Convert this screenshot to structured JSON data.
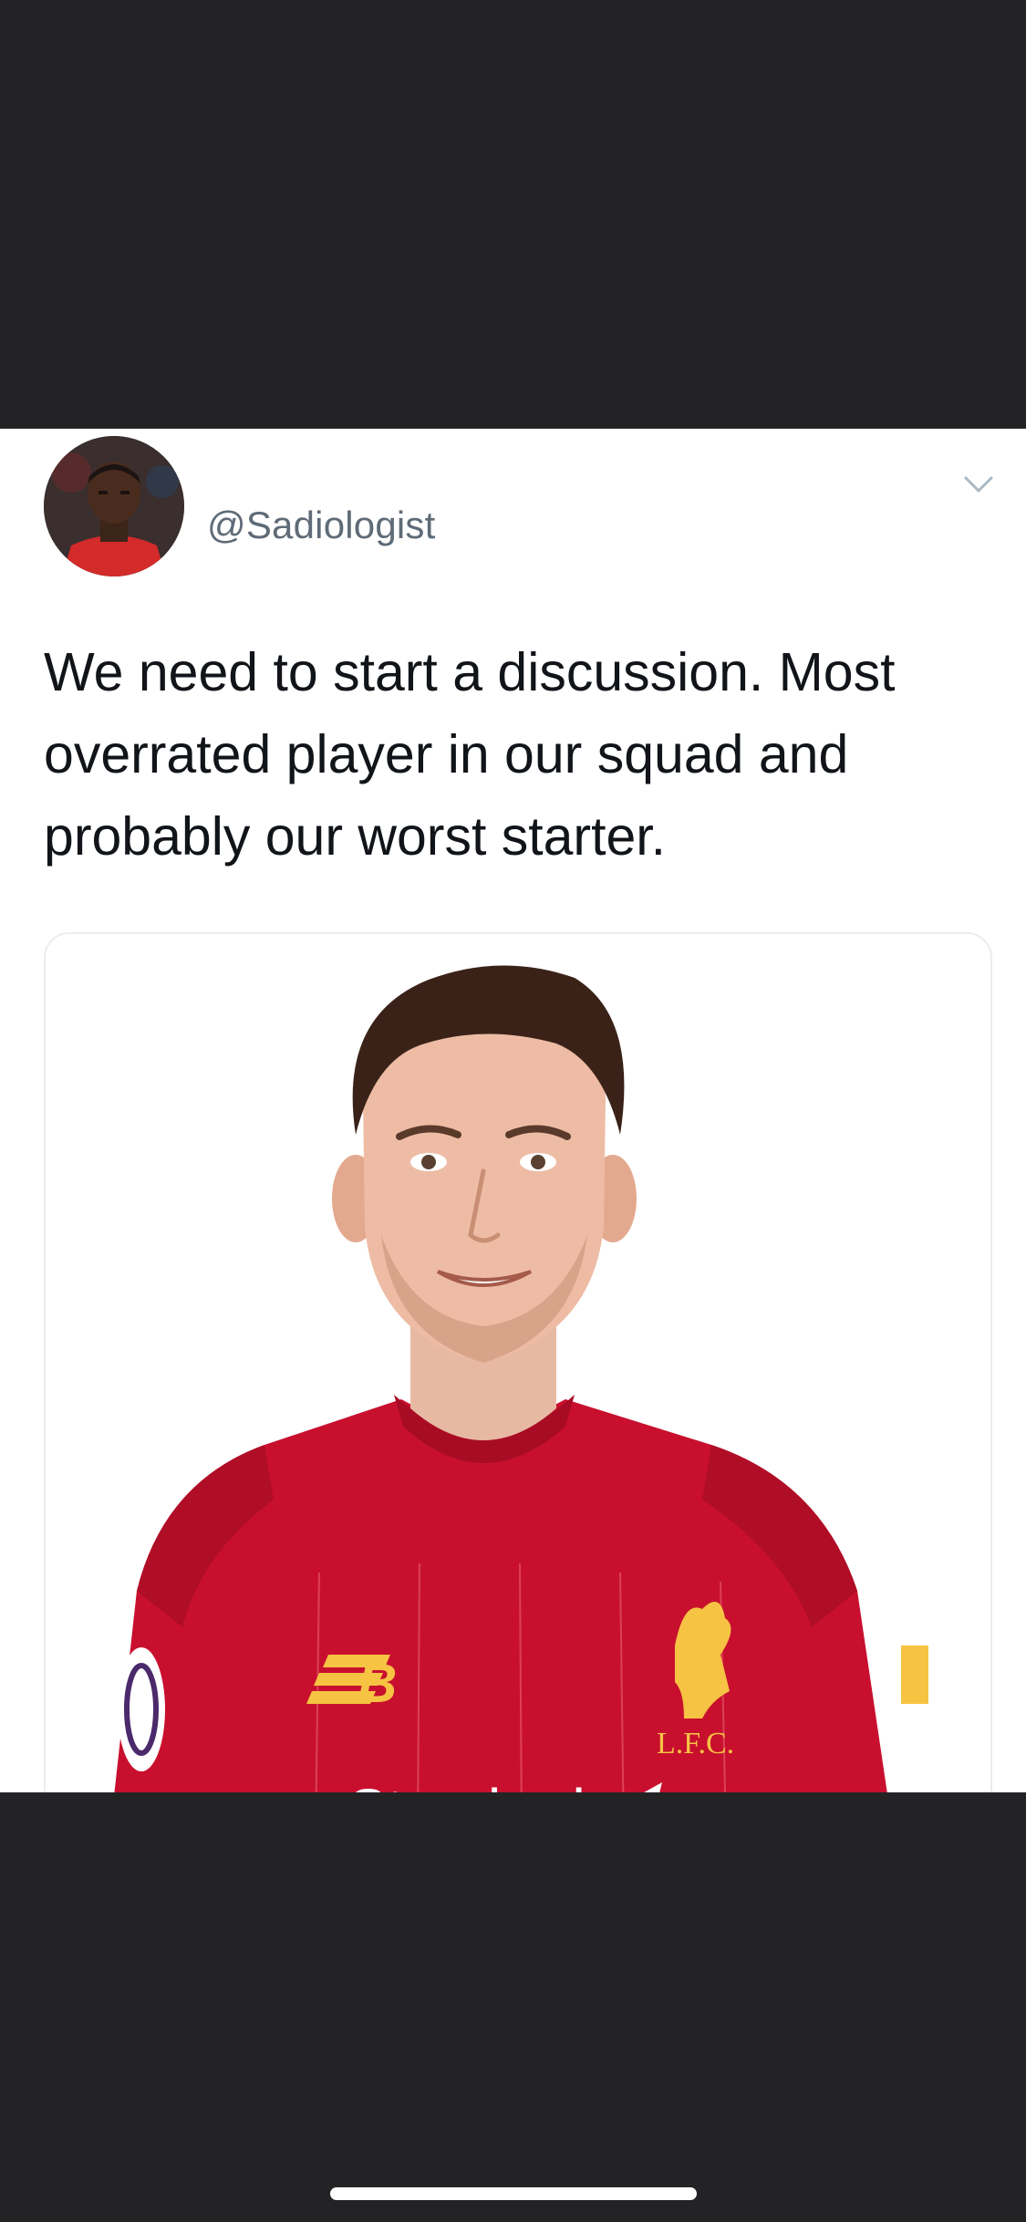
{
  "tweet": {
    "handle": "@Sadiologist",
    "text": "We need to start a discussion. Most overrated player in our squad and probably our worst starter.",
    "menu_icon": "chevron-down-icon",
    "avatar_icon": "profile-photo"
  },
  "media": {
    "crest_text": "L.F.C.",
    "sponsor_text": "Standard",
    "kit_brand_icon": "nb-logo-icon",
    "sleeve_badge_icon": "league-badge-icon"
  },
  "colors": {
    "background": "#232325",
    "card": "#ffffff",
    "text": "#111418",
    "handle": "#5f6b77",
    "kit_red": "#c8102e",
    "kit_gold": "#f6c343"
  }
}
